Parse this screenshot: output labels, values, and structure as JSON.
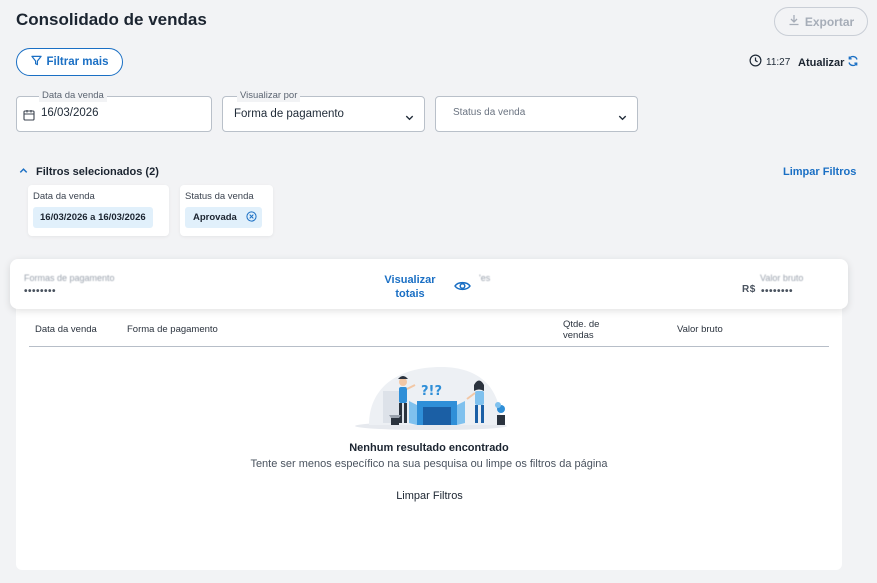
{
  "header": {
    "title": "Consolidado de vendas",
    "export_label": "Exportar"
  },
  "toolbar": {
    "filter_more_label": "Filtrar mais",
    "time": "11:27",
    "refresh_label": "Atualizar"
  },
  "filters": {
    "sale_date": {
      "label": "Data da venda",
      "value": "16/03/2026"
    },
    "view_by": {
      "label": "Visualizar por",
      "value": "Forma de pagamento"
    },
    "sale_status": {
      "placeholder": "Status da venda"
    }
  },
  "selected_filters": {
    "toggle_label": "Filtros selecionados (2)",
    "clear_label": "Limpar Filtros",
    "chips": [
      {
        "label": "Data da venda",
        "value": "16/03/2026 a 16/03/2026"
      },
      {
        "label": "Status da venda",
        "value": "Aprovada"
      }
    ]
  },
  "totals": {
    "payment_forms_label": "Formas de pagamento",
    "payment_forms_value": "••••••••",
    "view_totals_label": "Visualizar totais",
    "hidden_label_fragment": "'es",
    "gross_value_label": "Valor bruto",
    "gross_value_currency": "R$",
    "gross_value_value": "••••••••"
  },
  "table": {
    "columns": [
      "Data da venda",
      "Forma de pagamento",
      "Qtde. de vendas",
      "Valor bruto"
    ]
  },
  "empty_state": {
    "title": "Nenhum resultado encontrado",
    "subtitle": "Tente ser menos específico na sua pesquisa ou limpe os filtros da página",
    "clear_label": "Limpar Filtros"
  },
  "colors": {
    "accent": "#1a6fc4",
    "chip_bg": "#e1f0fb",
    "background": "#f2f3f5"
  },
  "icons": {
    "export": "download-icon",
    "filter": "funnel-icon",
    "time": "clock-icon",
    "refresh": "refresh-icon",
    "calendar": "calendar-icon",
    "chevron": "chevron-down-icon",
    "collapse": "chevron-up-icon",
    "remove_chip": "close-circle-icon",
    "eye": "eye-icon"
  }
}
